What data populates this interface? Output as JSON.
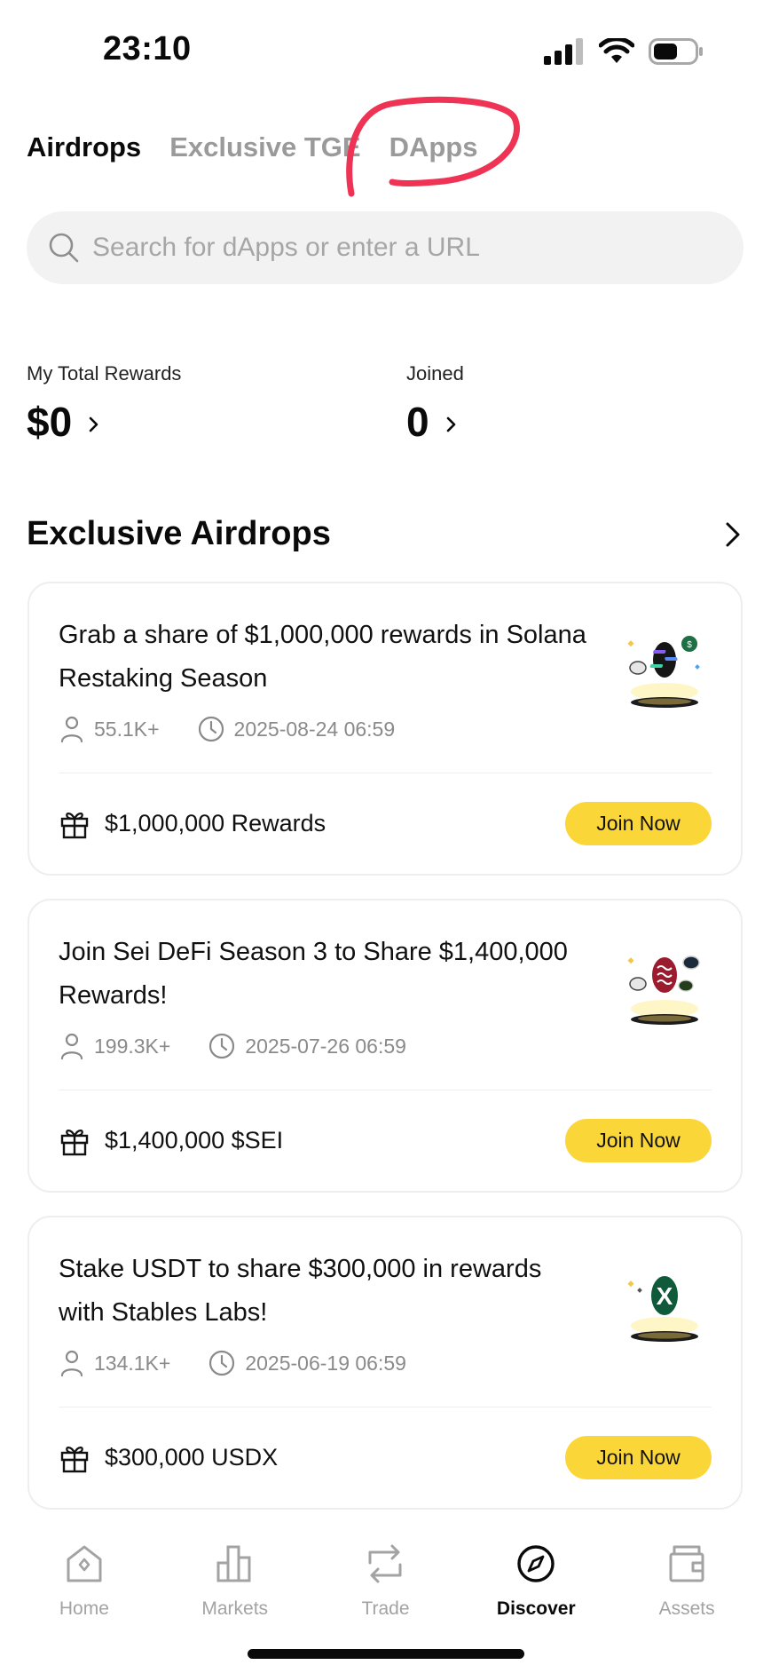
{
  "status_bar": {
    "time": "23:10"
  },
  "top_tabs": [
    {
      "label": "Airdrops",
      "active": true
    },
    {
      "label": "Exclusive TGE",
      "active": false
    },
    {
      "label": "DApps",
      "active": false
    }
  ],
  "search": {
    "placeholder": "Search for dApps or enter a URL",
    "value": ""
  },
  "stats": {
    "total_rewards": {
      "label": "My Total Rewards",
      "value": "$0"
    },
    "joined": {
      "label": "Joined",
      "value": "0"
    }
  },
  "section": {
    "title": "Exclusive Airdrops"
  },
  "cards": [
    {
      "title": "Grab a share of $1,000,000 rewards in Solana Restaking Season",
      "participants": "55.1K+",
      "end_time": "2025-08-24 06:59",
      "reward": "$1,000,000 Rewards",
      "button": "Join Now",
      "icon": "solana-token-icon"
    },
    {
      "title": "Join Sei DeFi Season 3 to Share $1,400,000 Rewards!",
      "participants": "199.3K+",
      "end_time": "2025-07-26 06:59",
      "reward": "$1,400,000 $SEI",
      "button": "Join Now",
      "icon": "sei-token-icon"
    },
    {
      "title": "Stake USDT to share $300,000 in rewards with Stables Labs!",
      "participants": "134.1K+",
      "end_time": "2025-06-19 06:59",
      "reward": "$300,000 USDX",
      "button": "Join Now",
      "icon": "usdx-token-icon"
    }
  ],
  "bottom_nav": [
    {
      "label": "Home",
      "icon": "home-icon",
      "active": false
    },
    {
      "label": "Markets",
      "icon": "bar-chart-icon",
      "active": false
    },
    {
      "label": "Trade",
      "icon": "swap-icon",
      "active": false
    },
    {
      "label": "Discover",
      "icon": "compass-icon",
      "active": true
    },
    {
      "label": "Assets",
      "icon": "wallet-icon",
      "active": false
    }
  ],
  "colors": {
    "accent": "#fad639",
    "annotation": "#ee3355",
    "muted_text": "#9a9a9a"
  }
}
